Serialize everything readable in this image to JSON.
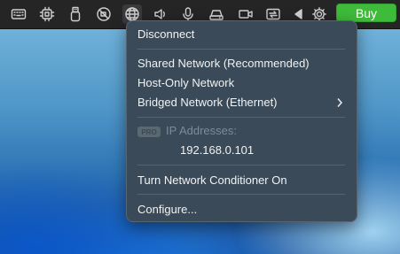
{
  "toolbar": {
    "icons": [
      "keyboard-icon",
      "cpu-icon",
      "usb-icon",
      "no-camera-icon",
      "network-globe-icon",
      "speaker-icon",
      "microphone-icon",
      "drive-icon",
      "camera-icon",
      "shared-folder-icon",
      "triangle-left-icon",
      "gear-icon"
    ],
    "buy_label": "Buy"
  },
  "menu": {
    "disconnect": "Disconnect",
    "shared": "Shared Network (Recommended)",
    "host_only": "Host-Only Network",
    "bridged": "Bridged Network (Ethernet)",
    "pro_badge": "PRO",
    "ip_label": "IP Addresses:",
    "ip_value": "192.168.0.101",
    "conditioner": "Turn Network Conditioner On",
    "configure": "Configure..."
  },
  "colors": {
    "buy": "#3fbb3a",
    "menu_bg": "#3a4a58",
    "toolbar_bg": "#252526"
  }
}
